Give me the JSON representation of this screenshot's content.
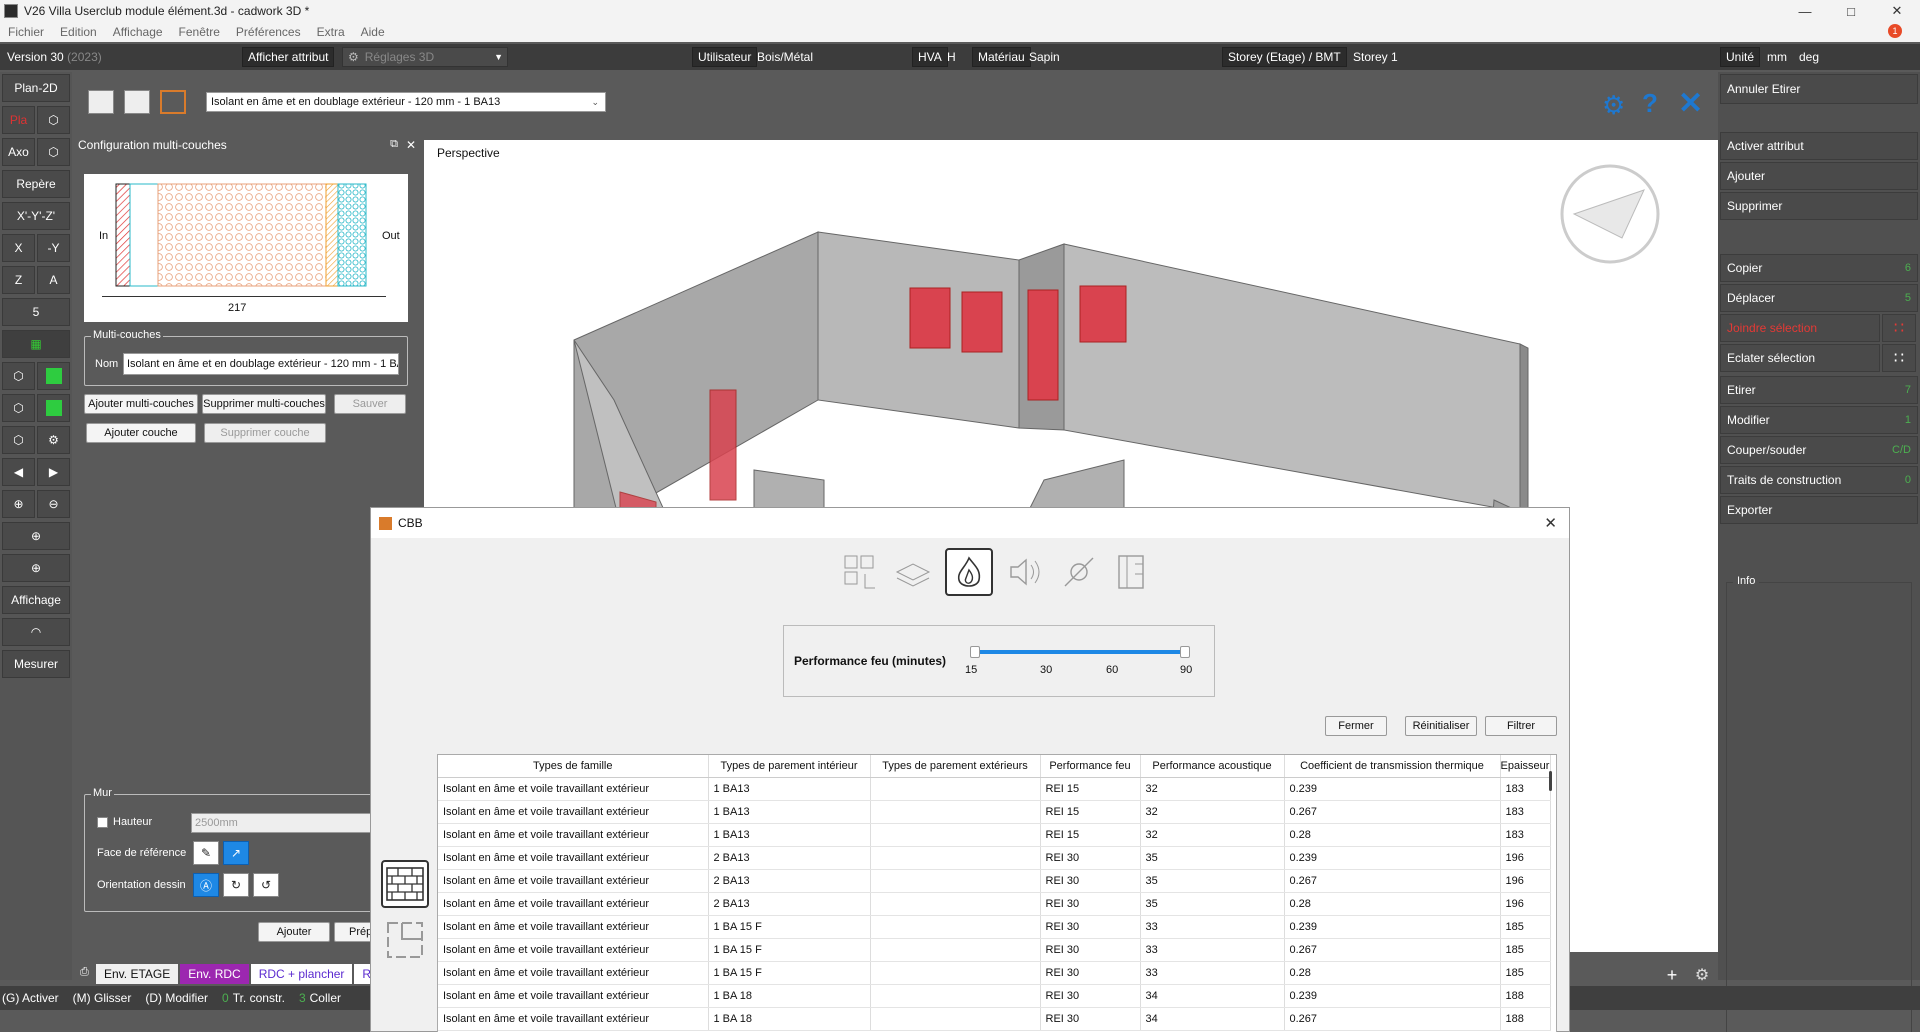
{
  "window": {
    "title": "V26 Villa Userclub module élément.3d - cadwork 3D *"
  },
  "menu": [
    "Fichier",
    "Edition",
    "Affichage",
    "Fenêtre",
    "Préférences",
    "Extra",
    "Aide"
  ],
  "notification_count": "1",
  "infobar": {
    "version": "Version 30",
    "version_year": "(2023)",
    "afficher_attribut": "Afficher attribut",
    "reglages": "Réglages 3D",
    "utilisateur_label": "Utilisateur",
    "utilisateur_value": "Bois/Métal",
    "hva_label": "HVA",
    "hva_value": "H",
    "materiau_label": "Matériau",
    "materiau_value": "Sapin",
    "storey_label": "Storey (Etage) / BMT",
    "storey_value": "Storey 1",
    "unite_label": "Unité",
    "unite_len": "mm",
    "unite_ang": "deg"
  },
  "lefttoolbar": {
    "plan2d": "Plan-2D",
    "plan": "Pla",
    "axo": "Axo",
    "repere": "Repère",
    "xyz": "X'-Y'-Z'",
    "x": "X",
    "my": "-Y",
    "z": "Z",
    "a": "A",
    "five": "5",
    "affichage": "Affichage",
    "mesurer": "Mesurer"
  },
  "config": {
    "title": "Configuration multi-couches",
    "dropdown_value": "Isolant en âme et en doublage extérieur - 120 mm - 1 BA13",
    "in_label": "In",
    "out_label": "Out",
    "thickness": "217",
    "multicouches_legend": "Multi-couches",
    "nom_label": "Nom",
    "nom_value": "Isolant en âme et en doublage extérieur - 120 mm - 1 BA13",
    "btn_ajouter_mc": "Ajouter multi-couches",
    "btn_supprimer_mc": "Supprimer multi-couches",
    "btn_sauver": "Sauver",
    "btn_ajouter_couche": "Ajouter couche",
    "btn_supprimer_couche": "Supprimer couche"
  },
  "mur": {
    "legend": "Mur",
    "hauteur_label": "Hauteur",
    "hauteur_value": "2500mm",
    "face_ref": "Face de référence",
    "orientation": "Orientation dessin",
    "btn_ajouter": "Ajouter",
    "btn_prep": "Prép"
  },
  "viewport": {
    "label": "Perspective"
  },
  "rightpanel": {
    "annuler": "Annuler Etirer",
    "items": [
      {
        "label": "Activer attribut",
        "key": ""
      },
      {
        "label": "Ajouter",
        "key": ""
      },
      {
        "label": "Supprimer",
        "key": ""
      },
      {
        "label": "Copier",
        "key": "6"
      },
      {
        "label": "Déplacer",
        "key": "5"
      },
      {
        "label": "Joindre sélection",
        "key": ""
      },
      {
        "label": "Eclater sélection",
        "key": ""
      },
      {
        "label": "Etirer",
        "key": "7"
      },
      {
        "label": "Modifier",
        "key": "1"
      },
      {
        "label": "Couper/souder",
        "key": "C/D"
      },
      {
        "label": "Traits de construction",
        "key": "0"
      },
      {
        "label": "Exporter",
        "key": ""
      }
    ],
    "info": "Info"
  },
  "bottomtabs": [
    "Env. ETAGE",
    "Env. RDC",
    "RDC + plancher",
    "RDC"
  ],
  "statusbar": {
    "g": "(G) Activer",
    "m": "(M) Glisser",
    "d": "(D) Modifier",
    "tr_key": "0",
    "tr": "Tr. constr.",
    "coller_key": "3",
    "coller": "Coller"
  },
  "cbb": {
    "title": "CBB",
    "perf_label": "Performance feu (minutes)",
    "ticks": [
      "15",
      "30",
      "60",
      "90"
    ],
    "range": {
      "min": 15,
      "max": 90,
      "low": 15,
      "high": 90
    },
    "btn_fermer": "Fermer",
    "btn_reinit": "Réinitialiser",
    "btn_filtrer": "Filtrer",
    "columns": [
      "Types de famille",
      "Types de parement intérieur",
      "Types de parement extérieurs",
      "Performance feu",
      "Performance acoustique",
      "Coefficient de transmission thermique",
      "Epaisseur"
    ],
    "rows": [
      [
        "Isolant en âme et voile travaillant extérieur",
        "1 BA13",
        "",
        "REI 15",
        "32",
        "0.239",
        "183"
      ],
      [
        "Isolant en âme et voile travaillant extérieur",
        "1 BA13",
        "",
        "REI 15",
        "32",
        "0.267",
        "183"
      ],
      [
        "Isolant en âme et voile travaillant extérieur",
        "1 BA13",
        "",
        "REI 15",
        "32",
        "0.28",
        "183"
      ],
      [
        "Isolant en âme et voile travaillant extérieur",
        "2 BA13",
        "",
        "REI 30",
        "35",
        "0.239",
        "196"
      ],
      [
        "Isolant en âme et voile travaillant extérieur",
        "2 BA13",
        "",
        "REI 30",
        "35",
        "0.267",
        "196"
      ],
      [
        "Isolant en âme et voile travaillant extérieur",
        "2 BA13",
        "",
        "REI 30",
        "35",
        "0.28",
        "196"
      ],
      [
        "Isolant en âme et voile travaillant extérieur",
        "1 BA 15 F",
        "",
        "REI 30",
        "33",
        "0.239",
        "185"
      ],
      [
        "Isolant en âme et voile travaillant extérieur",
        "1 BA 15 F",
        "",
        "REI 30",
        "33",
        "0.267",
        "185"
      ],
      [
        "Isolant en âme et voile travaillant extérieur",
        "1 BA 15 F",
        "",
        "REI 30",
        "33",
        "0.28",
        "185"
      ],
      [
        "Isolant en âme et voile travaillant extérieur",
        "1 BA 18",
        "",
        "REI 30",
        "34",
        "0.239",
        "188"
      ],
      [
        "Isolant en âme et voile travaillant extérieur",
        "1 BA 18",
        "",
        "REI 30",
        "34",
        "0.267",
        "188"
      ]
    ]
  },
  "colors": {
    "accent": "#1e88e5",
    "key_green": "#4caf50",
    "key_red": "#e53935",
    "model_red": "#d9434f"
  }
}
